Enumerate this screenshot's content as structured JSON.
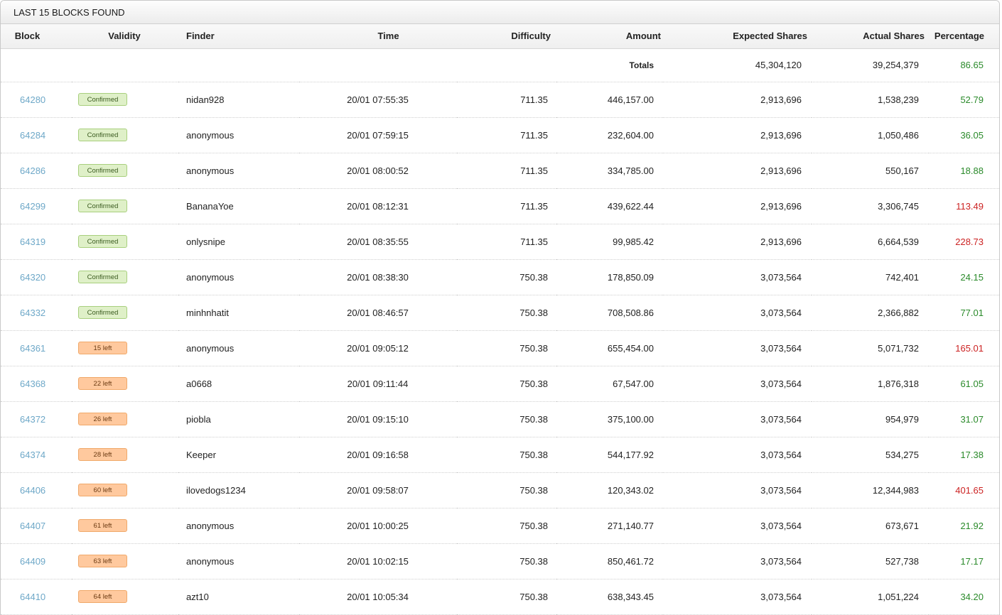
{
  "panel": {
    "title": "LAST 15 BLOCKS FOUND"
  },
  "columns": [
    "Block",
    "Validity",
    "Finder",
    "Time",
    "Difficulty",
    "Amount",
    "Expected Shares",
    "Actual Shares",
    "Percentage"
  ],
  "totals": {
    "label": "Totals",
    "expected_shares": "45,304,120",
    "actual_shares": "39,254,379",
    "percentage": "86.65"
  },
  "colors": {
    "link": "#6ea8c8",
    "good": "#2a8a2a",
    "bad": "#cc2222",
    "confirmed_bg": "#dff0c8",
    "pending_bg": "#ffc99e"
  },
  "rows": [
    {
      "block": "64280",
      "validity": "Confirmed",
      "status": "confirmed",
      "finder": "nidan928",
      "time": "20/01 07:55:35",
      "difficulty": "711.35",
      "amount": "446,157.00",
      "expected": "2,913,696",
      "actual": "1,538,239",
      "percentage": "52.79",
      "pct_state": "good"
    },
    {
      "block": "64284",
      "validity": "Confirmed",
      "status": "confirmed",
      "finder": "anonymous",
      "time": "20/01 07:59:15",
      "difficulty": "711.35",
      "amount": "232,604.00",
      "expected": "2,913,696",
      "actual": "1,050,486",
      "percentage": "36.05",
      "pct_state": "good"
    },
    {
      "block": "64286",
      "validity": "Confirmed",
      "status": "confirmed",
      "finder": "anonymous",
      "time": "20/01 08:00:52",
      "difficulty": "711.35",
      "amount": "334,785.00",
      "expected": "2,913,696",
      "actual": "550,167",
      "percentage": "18.88",
      "pct_state": "good"
    },
    {
      "block": "64299",
      "validity": "Confirmed",
      "status": "confirmed",
      "finder": "BananaYoe",
      "time": "20/01 08:12:31",
      "difficulty": "711.35",
      "amount": "439,622.44",
      "expected": "2,913,696",
      "actual": "3,306,745",
      "percentage": "113.49",
      "pct_state": "bad"
    },
    {
      "block": "64319",
      "validity": "Confirmed",
      "status": "confirmed",
      "finder": "onlysnipe",
      "time": "20/01 08:35:55",
      "difficulty": "711.35",
      "amount": "99,985.42",
      "expected": "2,913,696",
      "actual": "6,664,539",
      "percentage": "228.73",
      "pct_state": "bad"
    },
    {
      "block": "64320",
      "validity": "Confirmed",
      "status": "confirmed",
      "finder": "anonymous",
      "time": "20/01 08:38:30",
      "difficulty": "750.38",
      "amount": "178,850.09",
      "expected": "3,073,564",
      "actual": "742,401",
      "percentage": "24.15",
      "pct_state": "good"
    },
    {
      "block": "64332",
      "validity": "Confirmed",
      "status": "confirmed",
      "finder": "minhnhatit",
      "time": "20/01 08:46:57",
      "difficulty": "750.38",
      "amount": "708,508.86",
      "expected": "3,073,564",
      "actual": "2,366,882",
      "percentage": "77.01",
      "pct_state": "good"
    },
    {
      "block": "64361",
      "validity": "15 left",
      "status": "pending",
      "finder": "anonymous",
      "time": "20/01 09:05:12",
      "difficulty": "750.38",
      "amount": "655,454.00",
      "expected": "3,073,564",
      "actual": "5,071,732",
      "percentage": "165.01",
      "pct_state": "bad"
    },
    {
      "block": "64368",
      "validity": "22 left",
      "status": "pending",
      "finder": "a0668",
      "time": "20/01 09:11:44",
      "difficulty": "750.38",
      "amount": "67,547.00",
      "expected": "3,073,564",
      "actual": "1,876,318",
      "percentage": "61.05",
      "pct_state": "good"
    },
    {
      "block": "64372",
      "validity": "26 left",
      "status": "pending",
      "finder": "piobla",
      "time": "20/01 09:15:10",
      "difficulty": "750.38",
      "amount": "375,100.00",
      "expected": "3,073,564",
      "actual": "954,979",
      "percentage": "31.07",
      "pct_state": "good"
    },
    {
      "block": "64374",
      "validity": "28 left",
      "status": "pending",
      "finder": "Keeper",
      "time": "20/01 09:16:58",
      "difficulty": "750.38",
      "amount": "544,177.92",
      "expected": "3,073,564",
      "actual": "534,275",
      "percentage": "17.38",
      "pct_state": "good"
    },
    {
      "block": "64406",
      "validity": "60 left",
      "status": "pending",
      "finder": "ilovedogs1234",
      "time": "20/01 09:58:07",
      "difficulty": "750.38",
      "amount": "120,343.02",
      "expected": "3,073,564",
      "actual": "12,344,983",
      "percentage": "401.65",
      "pct_state": "bad"
    },
    {
      "block": "64407",
      "validity": "61 left",
      "status": "pending",
      "finder": "anonymous",
      "time": "20/01 10:00:25",
      "difficulty": "750.38",
      "amount": "271,140.77",
      "expected": "3,073,564",
      "actual": "673,671",
      "percentage": "21.92",
      "pct_state": "good"
    },
    {
      "block": "64409",
      "validity": "63 left",
      "status": "pending",
      "finder": "anonymous",
      "time": "20/01 10:02:15",
      "difficulty": "750.38",
      "amount": "850,461.72",
      "expected": "3,073,564",
      "actual": "527,738",
      "percentage": "17.17",
      "pct_state": "good"
    },
    {
      "block": "64410",
      "validity": "64 left",
      "status": "pending",
      "finder": "azt10",
      "time": "20/01 10:05:34",
      "difficulty": "750.38",
      "amount": "638,343.45",
      "expected": "3,073,564",
      "actual": "1,051,224",
      "percentage": "34.20",
      "pct_state": "good"
    }
  ]
}
